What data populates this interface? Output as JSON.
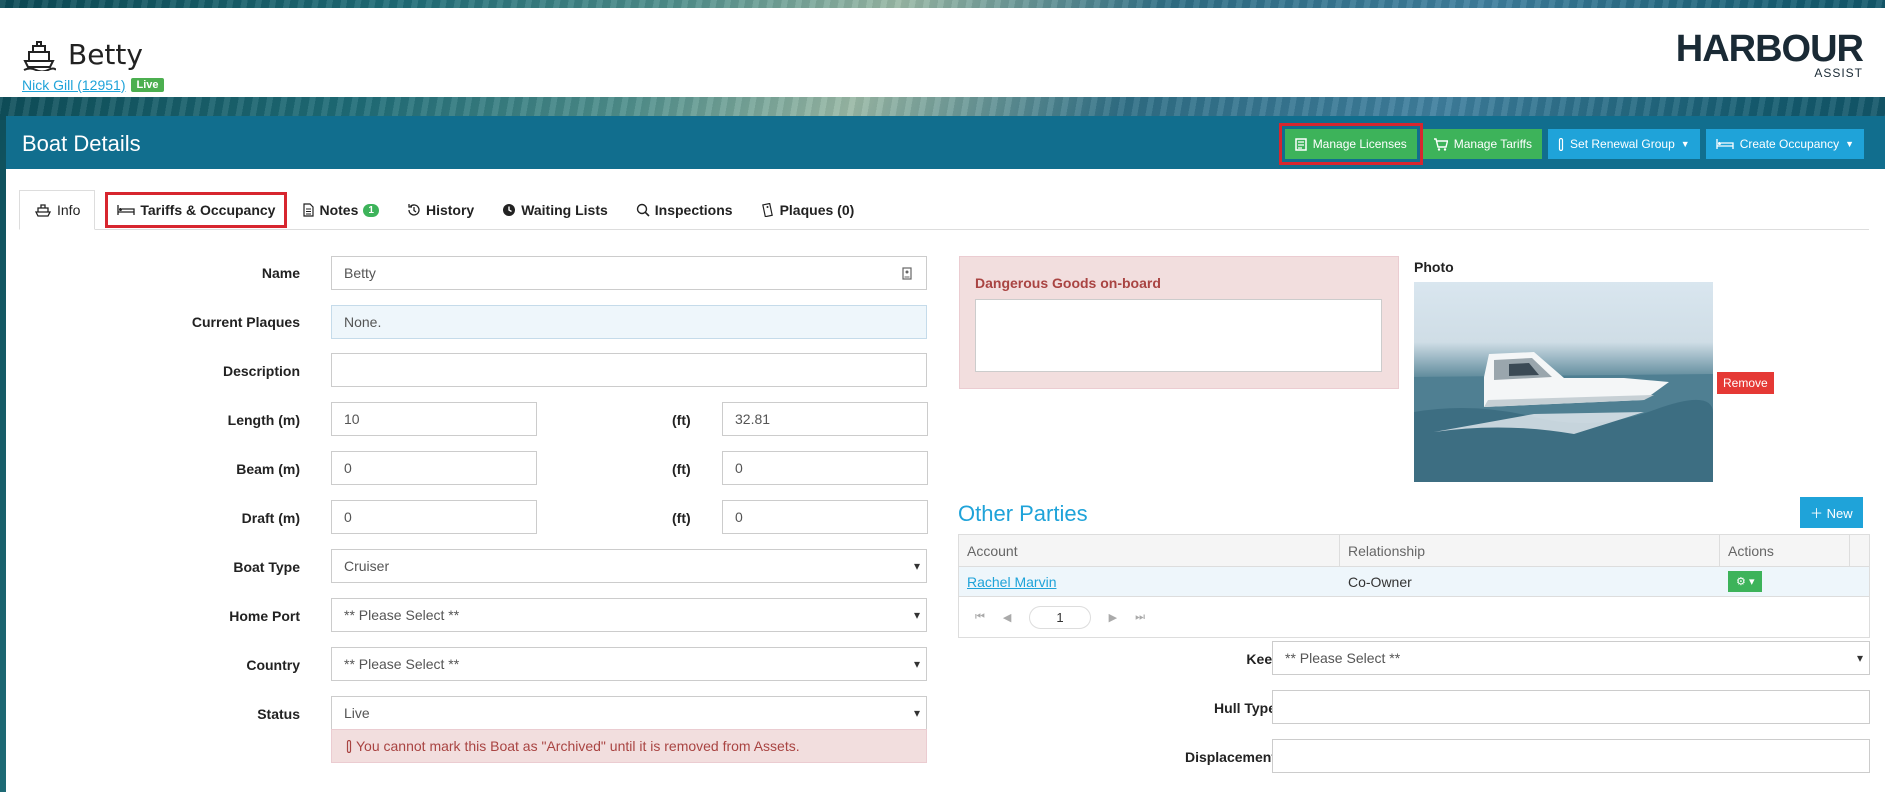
{
  "header": {
    "boat_name": "Betty",
    "owner_link": "Nick Gill (12951)",
    "status_badge": "Live",
    "logo_main": "HARBOUR",
    "logo_sub": "ASSIST"
  },
  "panel": {
    "title": "Boat Details",
    "buttons": {
      "manage_licenses": "Manage Licenses",
      "manage_tariffs": "Manage Tariffs",
      "set_renewal_group": "Set Renewal Group",
      "create_occupancy": "Create Occupancy"
    }
  },
  "tabs": [
    {
      "label": "Info"
    },
    {
      "label": "Tariffs & Occupancy"
    },
    {
      "label": "Notes",
      "count": "1"
    },
    {
      "label": "History"
    },
    {
      "label": "Waiting Lists"
    },
    {
      "label": "Inspections"
    },
    {
      "label": "Plaques (0)"
    }
  ],
  "form": {
    "name": {
      "label": "Name",
      "value": "Betty"
    },
    "current_plaques": {
      "label": "Current Plaques",
      "value": "None."
    },
    "description": {
      "label": "Description",
      "value": ""
    },
    "length": {
      "label": "Length (m)",
      "value": "10",
      "ft_label": "(ft)",
      "ft_value": "32.81"
    },
    "beam": {
      "label": "Beam (m)",
      "value": "0",
      "ft_label": "(ft)",
      "ft_value": "0"
    },
    "draft": {
      "label": "Draft (m)",
      "value": "0",
      "ft_label": "(ft)",
      "ft_value": "0"
    },
    "boat_type": {
      "label": "Boat Type",
      "value": "Cruiser"
    },
    "home_port": {
      "label": "Home Port",
      "value": "** Please Select **"
    },
    "country": {
      "label": "Country",
      "value": "** Please Select **"
    },
    "status": {
      "label": "Status",
      "value": "Live"
    },
    "status_warning": "You cannot mark this Boat as \"Archived\" until it is removed from Assets.",
    "keel": {
      "label": "Keel",
      "value": "** Please Select **"
    },
    "hull_type": {
      "label": "Hull Type",
      "value": ""
    },
    "displacement": {
      "label": "Displacement",
      "value": ""
    }
  },
  "dangerous_goods": {
    "title": "Dangerous Goods on-board",
    "value": ""
  },
  "photo": {
    "label": "Photo",
    "remove_label": "Remove"
  },
  "other_parties": {
    "title": "Other Parties",
    "new_label": "New",
    "columns": [
      "Account",
      "Relationship",
      "Actions"
    ],
    "rows": [
      {
        "account": "Rachel Marvin",
        "relationship": "Co-Owner"
      }
    ],
    "page": "1"
  },
  "colors": {
    "header_blue": "#116e8e",
    "green": "#3db35a",
    "blue": "#1fa3d9",
    "danger": "#a94442",
    "highlight_outline": "#d7262f"
  }
}
